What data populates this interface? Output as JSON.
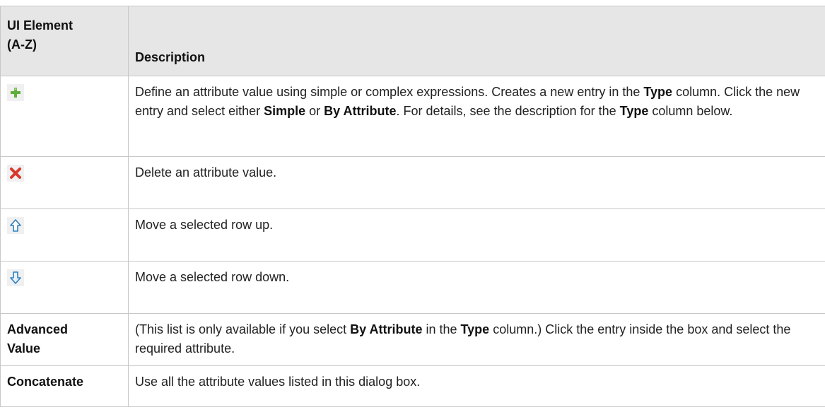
{
  "header": {
    "col1_line1": "UI Element",
    "col1_line2": "(A-Z)",
    "col2": "Description"
  },
  "rows": [
    {
      "icon": "add-icon",
      "desc": {
        "t1": "Define an attribute value using simple or complex expressions. Creates a new entry in the ",
        "b1": "Type",
        "t2": " column. Click the new entry and select either ",
        "b2": "Simple",
        "t3": " or ",
        "b3": "By Attribute",
        "t4": ". For details, see the description for the ",
        "b4": "Type",
        "t5": " column below."
      }
    },
    {
      "icon": "delete-icon",
      "desc": {
        "t1": "Delete an attribute value."
      }
    },
    {
      "icon": "move-up-icon",
      "desc": {
        "t1": "Move a selected row up."
      }
    },
    {
      "icon": "move-down-icon",
      "desc": {
        "t1": "Move a selected row down."
      }
    },
    {
      "name_line1": "Advanced",
      "name_line2": "Value",
      "desc": {
        "t1": "(This list is only available if you select ",
        "b1": "By Attribute",
        "t2": " in the ",
        "b2": "Type",
        "t3": " column.) Click the entry inside the box and select the required attribute."
      }
    },
    {
      "name": "Concatenate",
      "desc": {
        "t1": "Use all the attribute values listed in this dialog box."
      }
    }
  ]
}
